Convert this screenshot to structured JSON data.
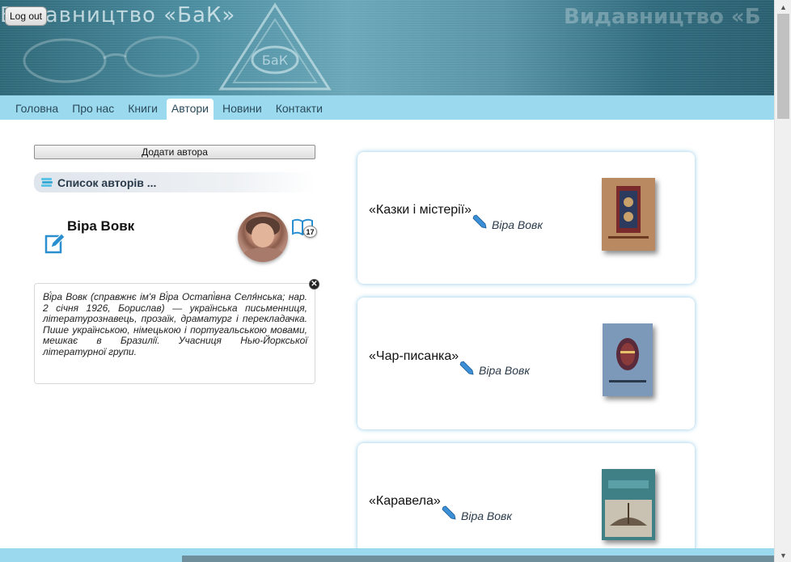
{
  "header": {
    "title": "Видавництво «БаК»",
    "watermark": "Видавництво «Б",
    "logout_label": "Log out"
  },
  "nav": {
    "items": [
      {
        "label": "Головна",
        "active": false
      },
      {
        "label": "Про нас",
        "active": false
      },
      {
        "label": "Книги",
        "active": false
      },
      {
        "label": "Автори",
        "active": true
      },
      {
        "label": "Новини",
        "active": false
      },
      {
        "label": "Контакти",
        "active": false
      }
    ]
  },
  "sidebar": {
    "add_author_label": "Додати автора",
    "list_header": "Список авторів ...",
    "author": {
      "name": "Віра Вовк",
      "book_count": "17",
      "bio": "Ві́ра Вовк (справжнє ім'я Ві́ра Остапі́вна Селя́нська; нар. 2 січня 1926, Борислав) — українська письменниця, літературознавець, прозаїк, драматург і перекладачка. Пише українською, німецькою і португальською мовами, мешкає в Бразилії. Учасниця Нью-Йоркської літературної групи."
    }
  },
  "books": [
    {
      "title": "«Казки і містерії»",
      "author": "Віра Вовк"
    },
    {
      "title": "«Чар-писанка»",
      "author": "Віра Вовк"
    },
    {
      "title": "«Каравела»",
      "author": "Віра Вовк"
    }
  ],
  "colors": {
    "nav_bg": "#9bd9ef",
    "banner": "#3f7f92",
    "card_glow": "#78bee1"
  }
}
